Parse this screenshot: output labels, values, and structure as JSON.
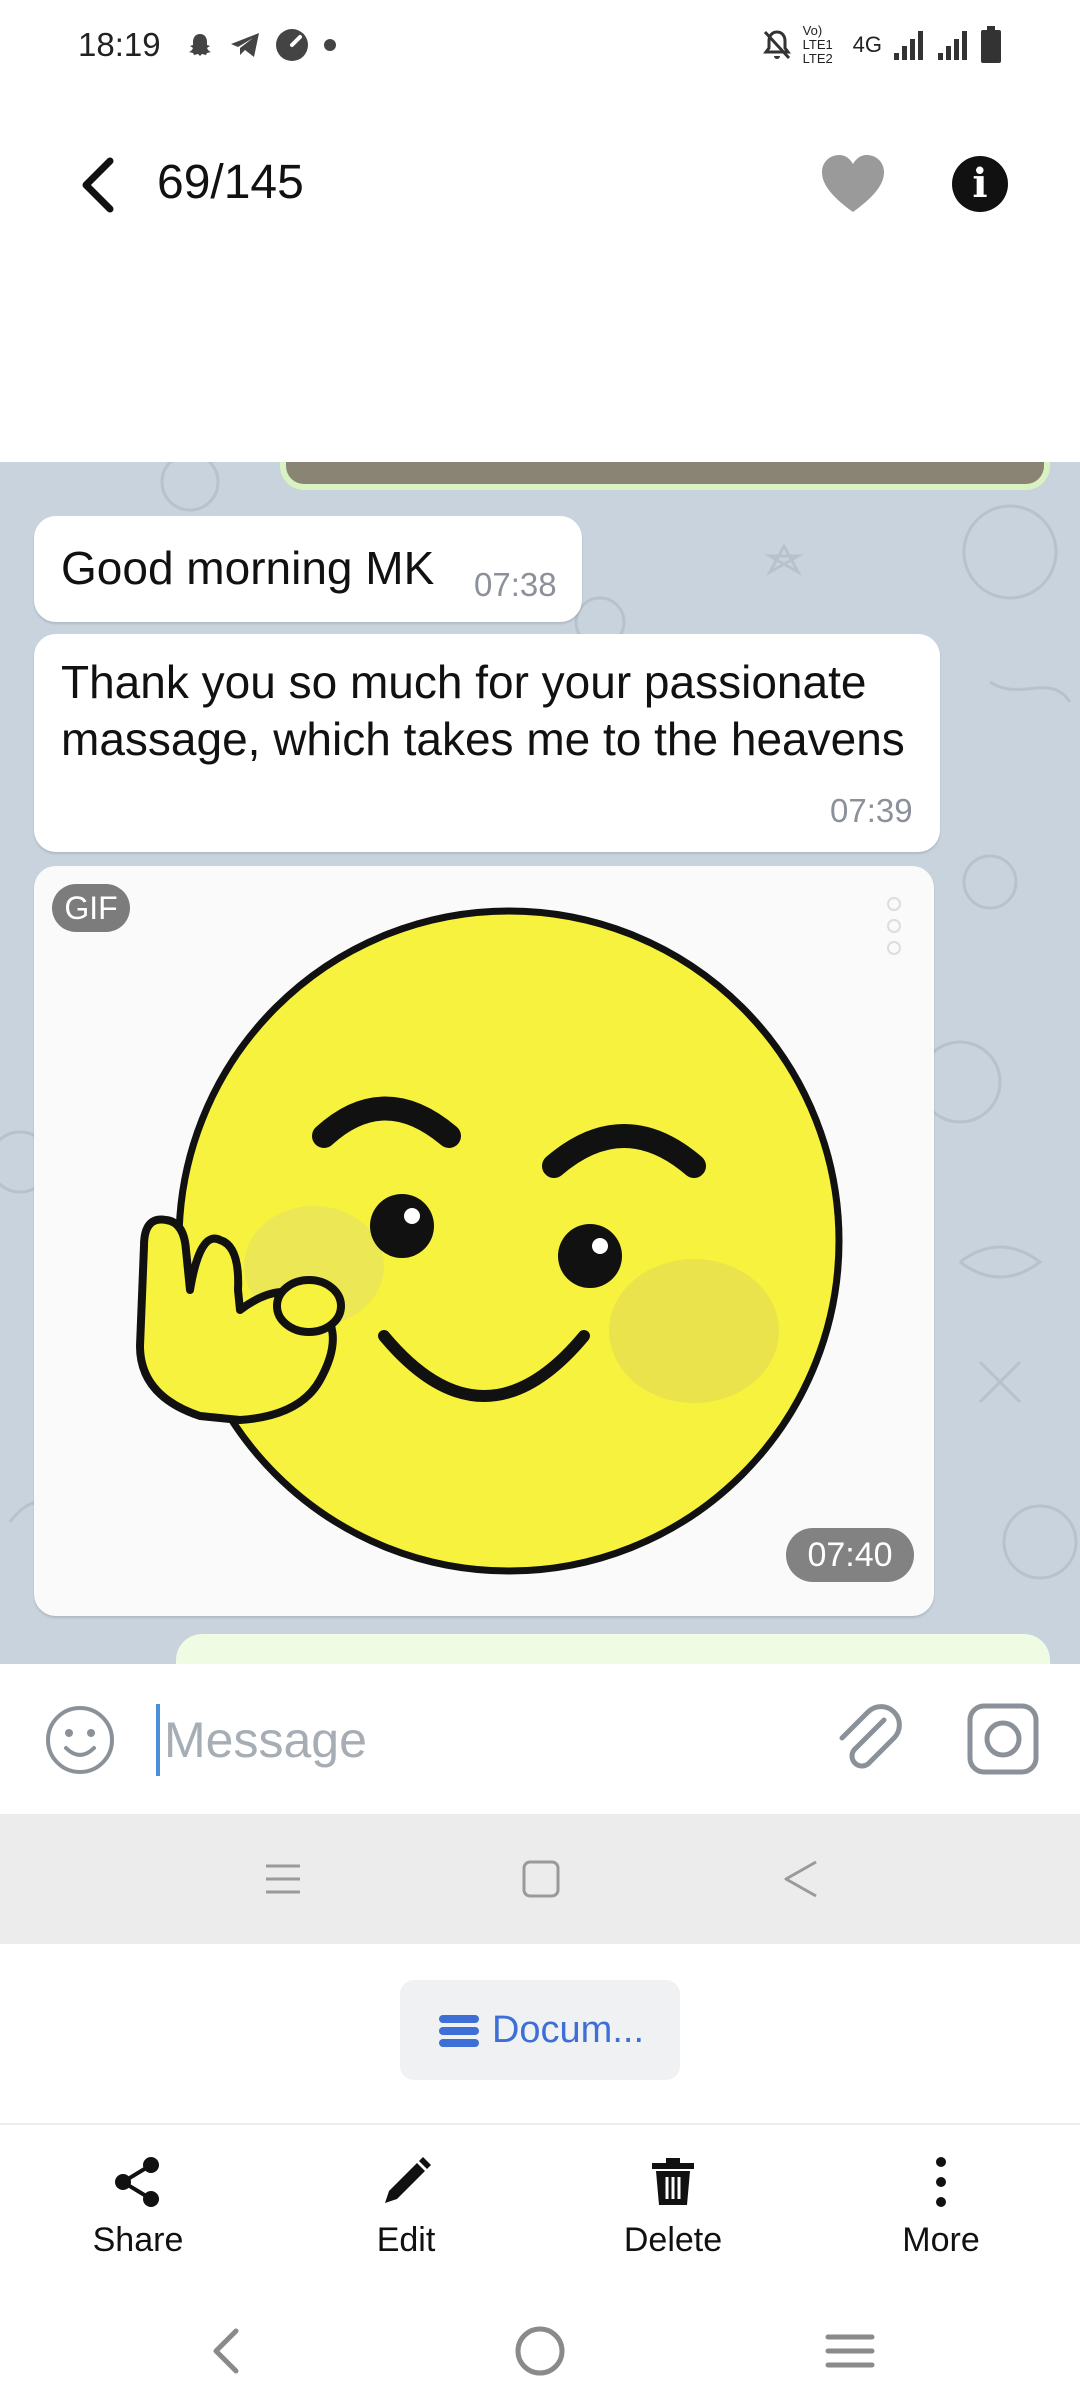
{
  "status_bar": {
    "time": "18:19",
    "network_label": "Vo) LTE1 LTE2",
    "network_type": "4G",
    "icons": [
      "snapchat-icon",
      "telegram-icon",
      "speedometer-icon",
      "dot-icon",
      "mute-icon",
      "signal-icon",
      "signal-icon",
      "battery-icon"
    ]
  },
  "header": {
    "counter": "69/145",
    "icons": [
      "back-arrow-icon",
      "heart-icon",
      "info-icon"
    ]
  },
  "messages": [
    {
      "text": "Good morning MK",
      "time": "07:38"
    },
    {
      "text": "Thank you so much for your passionate massage, which takes me to the heavens",
      "time": "07:39"
    },
    {
      "badge": "GIF",
      "time": "07:40",
      "media": "winking-ok-hand-emoji"
    }
  ],
  "composer": {
    "placeholder": "Message",
    "value": ""
  },
  "document_chip": {
    "label": "Docum..."
  },
  "actions": [
    {
      "label": "Share",
      "icon": "share-icon"
    },
    {
      "label": "Edit",
      "icon": "pencil-icon"
    },
    {
      "label": "Delete",
      "icon": "trash-icon"
    },
    {
      "label": "More",
      "icon": "more-vertical-icon"
    }
  ],
  "colors": {
    "chat_background": "#c8d3dd",
    "outgoing_bubble": "#effbe3",
    "accent_blue": "#3e6fd6",
    "emoji_yellow": "#f7f23e"
  }
}
